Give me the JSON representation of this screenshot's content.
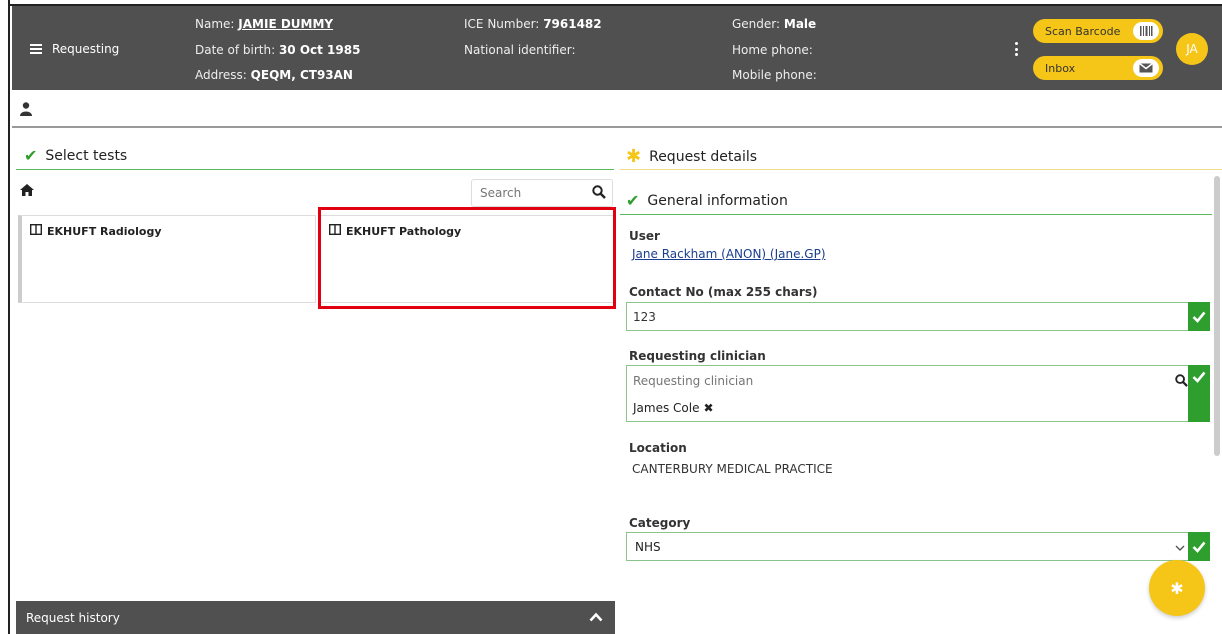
{
  "header": {
    "menu_label": "Requesting",
    "name_label": "Name:",
    "name_value": "JAMIE DUMMY",
    "dob_label": "Date of birth:",
    "dob_value": "30 Oct 1985",
    "address_label": "Address:",
    "address_value": "QEQM, CT93AN",
    "ice_label": "ICE Number:",
    "ice_value": "7961482",
    "national_id_label": "National identifier:",
    "national_id_value": "",
    "gender_label": "Gender:",
    "gender_value": "Male",
    "home_phone_label": "Home phone:",
    "home_phone_value": "",
    "mobile_phone_label": "Mobile phone:",
    "mobile_phone_value": "",
    "scan_barcode_label": "Scan Barcode",
    "inbox_label": "Inbox",
    "avatar_initials": "JA"
  },
  "left": {
    "section_title": "Select tests",
    "search_placeholder": "Search",
    "tiles": [
      {
        "label": "EKHUFT Radiology"
      },
      {
        "label": "EKHUFT Pathology"
      }
    ],
    "history_label": "Request history"
  },
  "right": {
    "section_title": "Request details",
    "general_title": "General information",
    "user_label": "User",
    "user_value": "Jane Rackham (ANON) (Jane.GP)",
    "contact_label": "Contact No (max 255 chars)",
    "contact_value": "123",
    "clinician_label": "Requesting clinician",
    "clinician_placeholder": "Requesting clinician",
    "clinician_selected": "James Cole",
    "location_label": "Location",
    "location_value": "CANTERBURY MEDICAL PRACTICE",
    "category_label": "Category",
    "category_value": "NHS"
  },
  "colors": {
    "header_bg": "#505050",
    "accent_yellow": "#f5c518",
    "success_green": "#2e9e2e",
    "highlight_red": "#e0000f"
  }
}
